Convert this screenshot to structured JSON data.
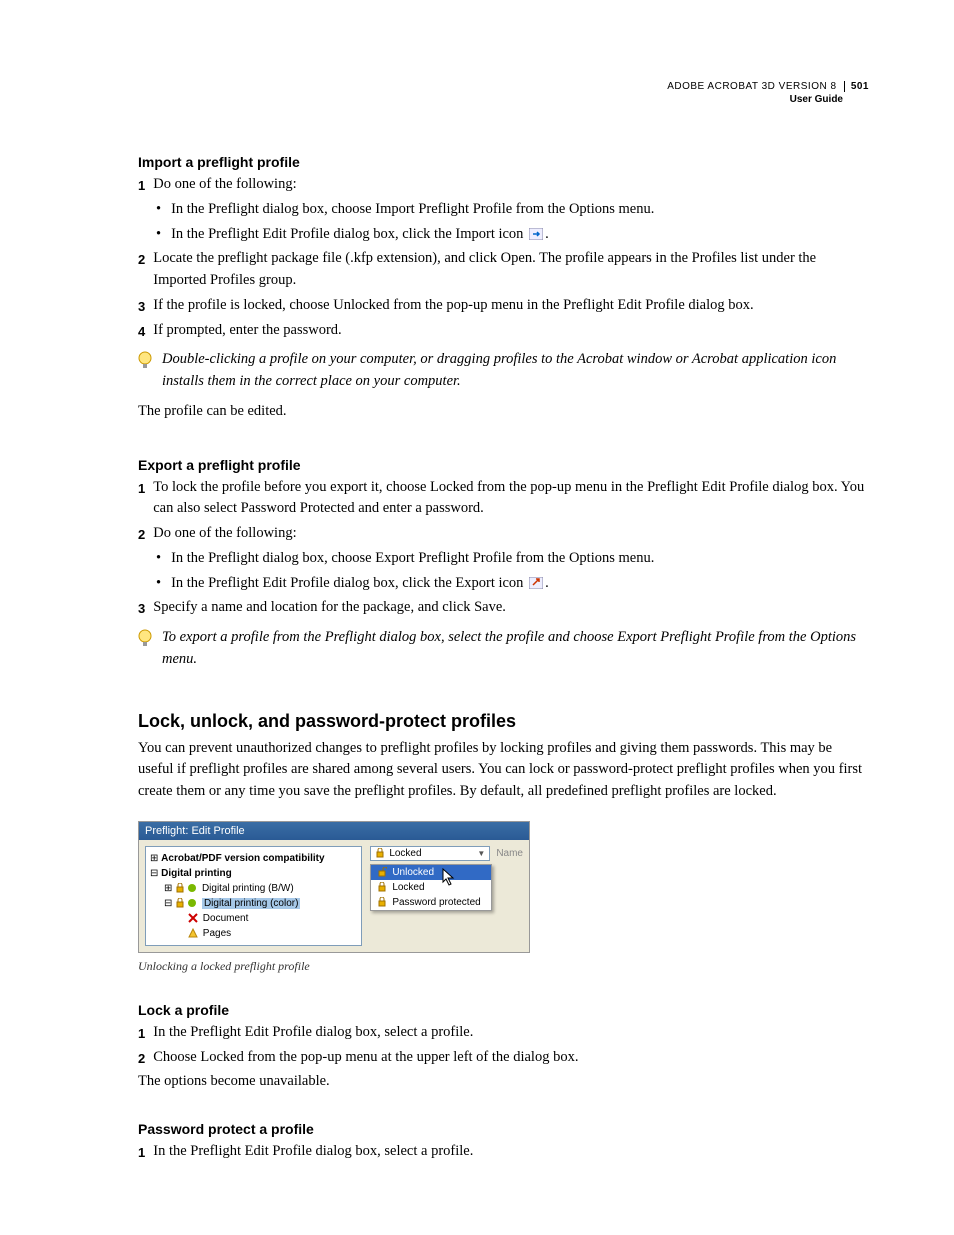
{
  "header": {
    "product": "ADOBE ACROBAT 3D VERSION 8",
    "page": "501",
    "subtitle": "User Guide"
  },
  "import": {
    "heading": "Import a preflight profile",
    "step1": "Do one of the following:",
    "bullet1": "In the Preflight dialog box, choose Import Preflight Profile from the Options menu.",
    "bullet2a": "In the Preflight Edit Profile dialog box, click the Import icon ",
    "bullet2b": ".",
    "step2": "Locate the preflight package file (.kfp extension), and click Open. The profile appears in the Profiles list under the Imported Profiles group.",
    "step3": "If the profile is locked, choose Unlocked from the pop-up menu in the Preflight Edit Profile dialog box.",
    "step4": "If prompted, enter the password.",
    "tip": "Double-clicking a profile on your computer, or dragging profiles to the Acrobat window or Acrobat application icon installs them in the correct place on your computer.",
    "after_tip": "The profile can be edited."
  },
  "export": {
    "heading": "Export a preflight profile",
    "step1": "To lock the profile before you export it, choose Locked from the pop-up menu in the Preflight Edit Profile dialog box. You can also select Password Protected and enter a password.",
    "step2": "Do one of the following:",
    "bullet1": "In the Preflight dialog box, choose Export Preflight Profile from the Options menu.",
    "bullet2a": "In the Preflight Edit Profile dialog box, click the Export icon ",
    "bullet2b": ".",
    "step3": "Specify a name and location for the package, and click Save.",
    "tip": "To export a profile from the Preflight dialog box, select the profile and choose Export Preflight Profile from the Options menu."
  },
  "lock": {
    "heading": "Lock, unlock, and password-protect profiles",
    "intro": "You can prevent unauthorized changes to preflight profiles by locking profiles and giving them passwords. This may be useful if preflight profiles are shared among several users. You can lock or password-protect preflight profiles when you first create them or any time you save the preflight profiles. By default, all predefined preflight profiles are locked.",
    "caption": "Unlocking a locked preflight profile",
    "profile_head": "Lock a profile",
    "p1_step1": "In the Preflight Edit Profile dialog box, select a profile.",
    "p1_step2": "Choose Locked from the pop-up menu at the upper left of the dialog box.",
    "p1_after": "The options become unavailable.",
    "pw_head": "Password protect a profile",
    "pw_step1": "In the Preflight Edit Profile dialog box, select a profile."
  },
  "figure": {
    "title": "Preflight: Edit Profile",
    "tree": {
      "root": "Acrobat/PDF version compatibility",
      "group": "Digital printing",
      "item1": "Digital printing (B/W)",
      "item2": "Digital printing (color)",
      "sub1": "Document",
      "sub2": "Pages"
    },
    "dropdown_current": "Locked",
    "right_label": "Name",
    "options": {
      "opt1": "Unlocked",
      "opt2": "Locked",
      "opt3": "Password protected"
    }
  }
}
